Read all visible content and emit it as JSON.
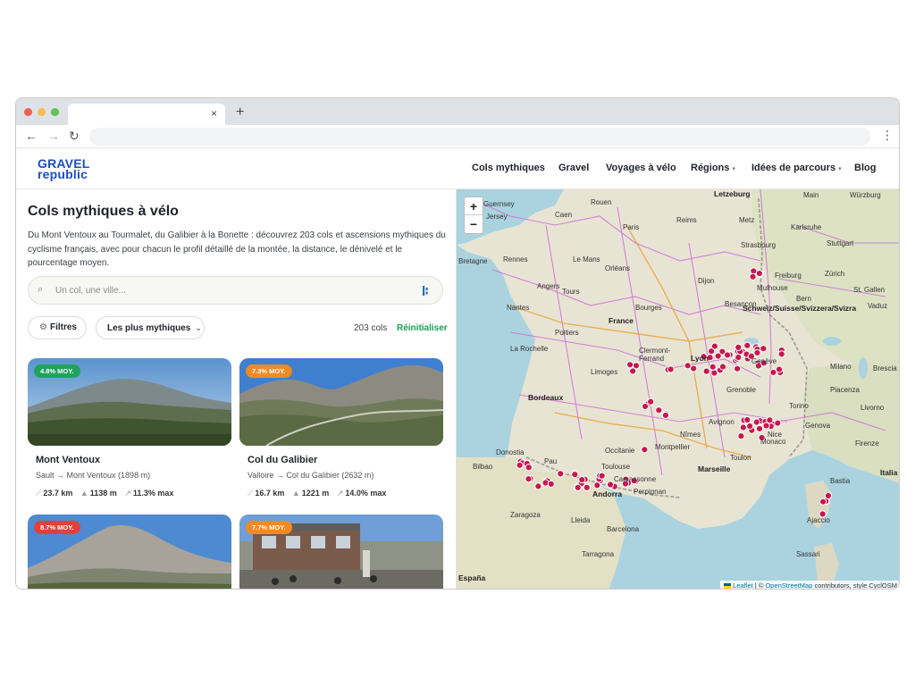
{
  "browser": {
    "new_tab_symbol": "+",
    "close_symbol": "×"
  },
  "site": {
    "logo_line1": "GRAVEL",
    "logo_line2": "republic",
    "nav": [
      {
        "label": "Cols mythiques",
        "dropdown": false
      },
      {
        "label": "Gravel",
        "dropdown": false
      },
      {
        "label": "Voyages à vélo",
        "dropdown": false
      },
      {
        "label": "Régions",
        "dropdown": true
      },
      {
        "label": "Idées de parcours",
        "dropdown": true
      },
      {
        "label": "Blog",
        "dropdown": false
      }
    ]
  },
  "page": {
    "title": "Cols mythiques à vélo",
    "intro": "Du Mont Ventoux au Tourmalet, du Galibier à la Bonette : découvrez 203 cols et ascensions mythiques du cyclisme français, avec pour chacun le profil détaillé de la montée, la distance, le dénivelé et le pourcentage moyen.",
    "search_placeholder": "Un col, une ville...",
    "filters_label": "Filtres",
    "sort_label": "Les plus mythiques",
    "count_label": "203 cols",
    "reset_label": "Réinitialiser"
  },
  "cards": [
    {
      "badge": "4.8% MOY.",
      "badge_color": "#1fa35c",
      "title": "Mont Ventoux",
      "route": "Sault → Mont Ventoux (1898 m)",
      "distance": "23.7 km",
      "elevation": "1138 m",
      "max": "11.3% max"
    },
    {
      "badge": "7.3% MOY.",
      "badge_color": "#f08a24",
      "title": "Col du Galibier",
      "route": "Valloire → Col du Galibier (2632 m)",
      "distance": "16.7 km",
      "elevation": "1221 m",
      "max": "14.0% max"
    },
    {
      "badge": "8.7% MOY.",
      "badge_color": "#e0413c"
    },
    {
      "badge": "7.7% MOY.",
      "badge_color": "#f08a24"
    }
  ],
  "map": {
    "zoom_in": "+",
    "zoom_out": "−",
    "attribution_leaflet": "Leaflet",
    "attribution_sep": " | © ",
    "attribution_osm": "OpenStreetMap",
    "attribution_rest": " contributors, style CyclOSM",
    "marker_color": "#c8174f",
    "labels": [
      "Jersey",
      "Guernsey",
      "Letzeburg",
      "Main",
      "Würzburg",
      "France",
      "Caen",
      "Rouen",
      "Paris",
      "Reims",
      "Metz",
      "Strasbourg",
      "Karlsruhe",
      "Stuttgart",
      "Rennes",
      "Orléans",
      "Nantes",
      "Bretagne",
      "Tours",
      "Freiburg",
      "Dijon",
      "Schweiz/Suisse/Svizzera/Svizra",
      "Zürich",
      "Bern",
      "St. Gallen",
      "Vaduz",
      "Limoges",
      "Clermont-Ferrand",
      "Lyon",
      "Genève",
      "Bordeaux",
      "Grenoble",
      "Torino",
      "Milano",
      "Brescia",
      "Piacenza",
      "Genova",
      "Toulouse",
      "Montpellier",
      "Marseille",
      "Nice",
      "Monaco",
      "Firenze",
      "Bilbao",
      "Pau",
      "Andorra",
      "Perpignan",
      "Barcelona",
      "Bastia",
      "Ajaccio",
      "Italia",
      "Sassari",
      "España",
      "Livorno",
      "Lleida",
      "Zaragoza",
      "Donostia",
      "Tarragona",
      "La Rochelle",
      "Poitiers",
      "Angers",
      "Le Mans",
      "Bourges",
      "Besançon",
      "Mulhouse",
      "Toulon",
      "Nîmes",
      "Avignon",
      "Carcassonne",
      "Occitanie"
    ]
  }
}
